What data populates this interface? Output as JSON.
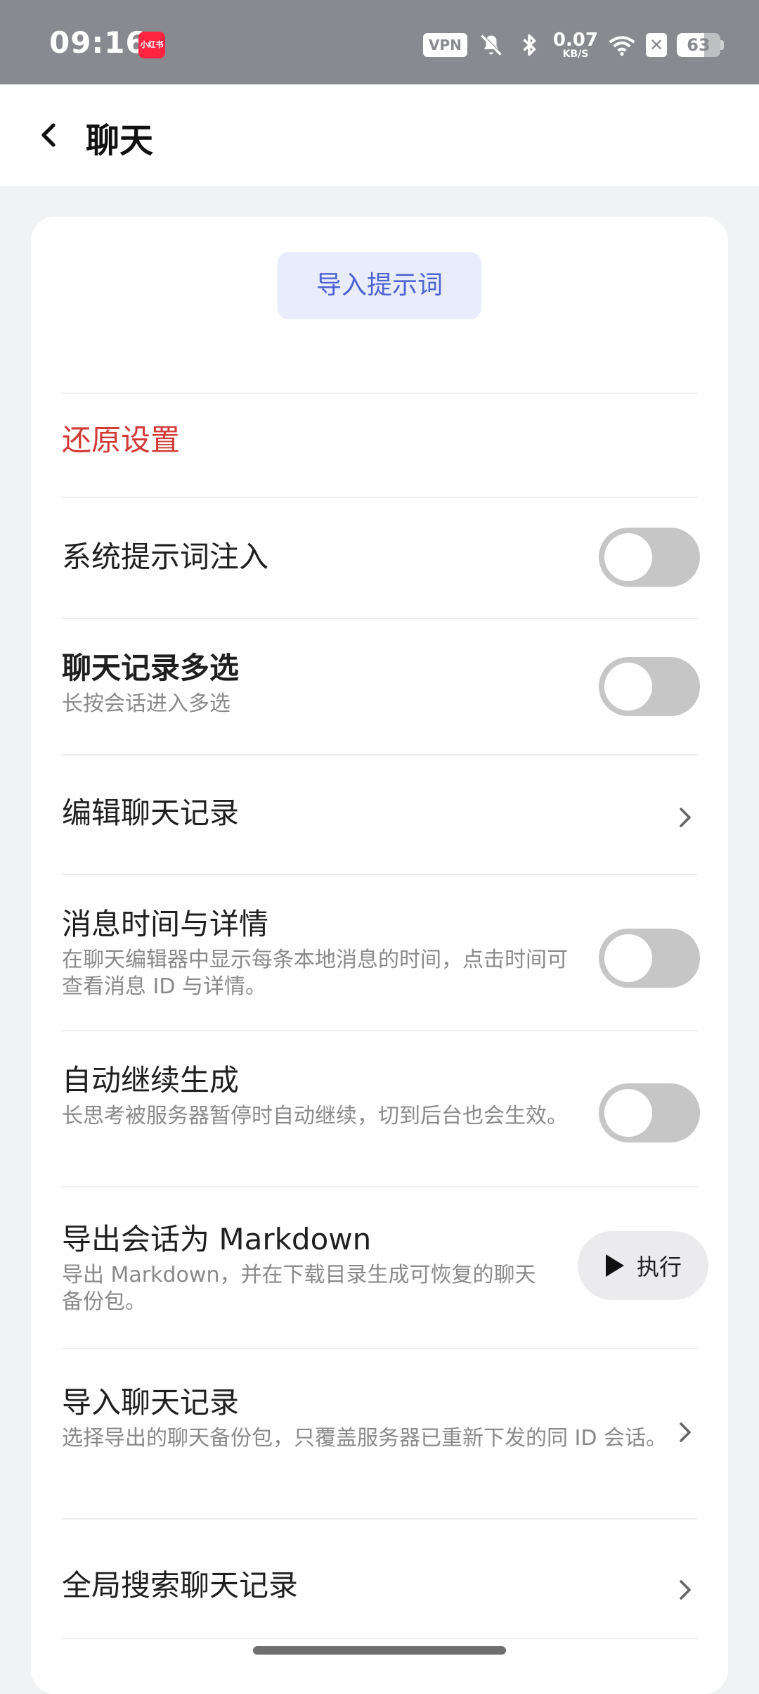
{
  "status_bar": {
    "time": "09:16",
    "app_icon_label": "小红书",
    "vpn": "VPN",
    "net_speed_value": "0.07",
    "net_speed_unit": "KB/S",
    "battery": "63",
    "battery_level": 0.63,
    "icons": [
      "mute-bell-icon",
      "bluetooth-icon",
      "wifi-icon",
      "sim-off-icon",
      "battery-icon"
    ]
  },
  "header": {
    "back_icon": "chevron-left-icon",
    "title": "聊天"
  },
  "card": {
    "import_prompt_label": "导入提示词",
    "reset_label": "还原设置",
    "settings": [
      {
        "id": "system-prompt-inject",
        "title": "系统提示词注入",
        "subtitle": "",
        "control": "toggle",
        "on": false
      },
      {
        "id": "chat-multiselect",
        "title": "聊天记录多选",
        "subtitle": "长按会话进入多选",
        "control": "toggle",
        "on": false
      },
      {
        "id": "edit-chat-history",
        "title": "编辑聊天记录",
        "subtitle": "",
        "control": "chevron"
      },
      {
        "id": "message-time-details",
        "title": "消息时间与详情",
        "subtitle": "在聊天编辑器中显示每条本地消息的时间，点击时间可查看消息 ID 与详情。",
        "control": "toggle",
        "on": false
      },
      {
        "id": "auto-continue",
        "title": "自动继续生成",
        "subtitle": "长思考被服务器暂停时自动继续，切到后台也会生效。",
        "control": "toggle",
        "on": false
      },
      {
        "id": "export-markdown",
        "title": "导出会话为 Markdown",
        "subtitle": "导出 Markdown，并在下载目录生成可恢复的聊天备份包。",
        "control": "button",
        "button_label": "执行"
      },
      {
        "id": "import-chat-history",
        "title": "导入聊天记录",
        "subtitle": "选择导出的聊天备份包，只覆盖服务器已重新下发的同 ID 会话。",
        "control": "chevron"
      },
      {
        "id": "global-search",
        "title": "全局搜索聊天记录",
        "subtitle": "",
        "control": "chevron"
      }
    ]
  },
  "colors": {
    "status_bar_bg": "#898a8f",
    "page_bg": "#f1f2f4",
    "accent_blue": "#4d63d1",
    "accent_blue_bg": "#e9ecfb",
    "danger_red": "#d23a36",
    "toggle_off": "#c6c6c6"
  }
}
